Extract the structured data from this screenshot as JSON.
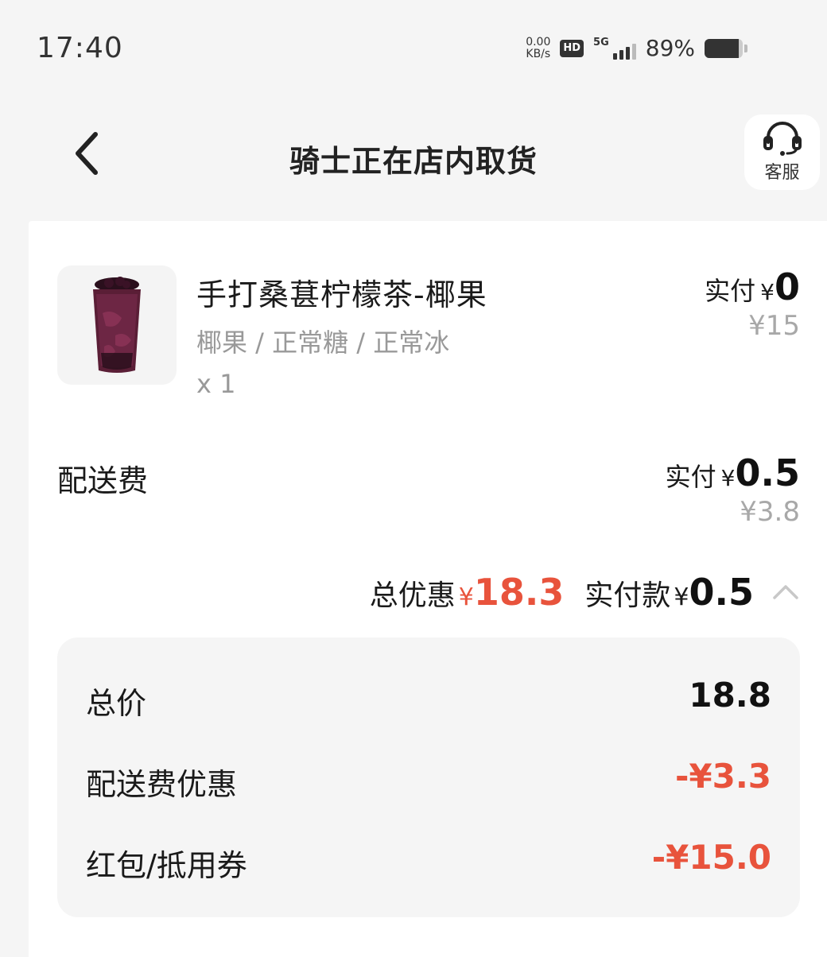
{
  "status_bar": {
    "time": "17:40",
    "net_speed_value": "0.00",
    "net_speed_unit": "KB/s",
    "hd_badge": "HD",
    "network_type": "5G",
    "battery_percent": "89%",
    "battery_level": 0.89
  },
  "nav": {
    "title": "骑士正在店内取货",
    "customer_service_label": "客服"
  },
  "product": {
    "name": "手打桑葚柠檬茶-椰果",
    "spec": "椰果 / 正常糖 / 正常冰",
    "qty": "x 1",
    "paid_label": "实付",
    "currency": "¥",
    "paid_amount": "0",
    "original_price": "¥15"
  },
  "delivery": {
    "label": "配送费",
    "paid_label": "实付",
    "currency": "¥",
    "paid_amount": "0.5",
    "original_price": "¥3.8"
  },
  "summary": {
    "discount_label": "总优惠",
    "currency": "¥",
    "discount_amount": "18.3",
    "pay_label": "实付款",
    "pay_amount": "0.5"
  },
  "breakdown": [
    {
      "label": "总价",
      "value": "18.8"
    },
    {
      "label": "配送费优惠",
      "value": "-¥3.3"
    },
    {
      "label": "红包/抵用券",
      "value": "-¥15.0"
    }
  ],
  "colors": {
    "accent_red": "#e8533c",
    "page_bg": "#f5f5f5",
    "card_bg": "#ffffff"
  },
  "icons": {
    "back": "chevron-left-icon",
    "customer_service": "headset-icon",
    "collapse": "chevron-up-icon"
  }
}
